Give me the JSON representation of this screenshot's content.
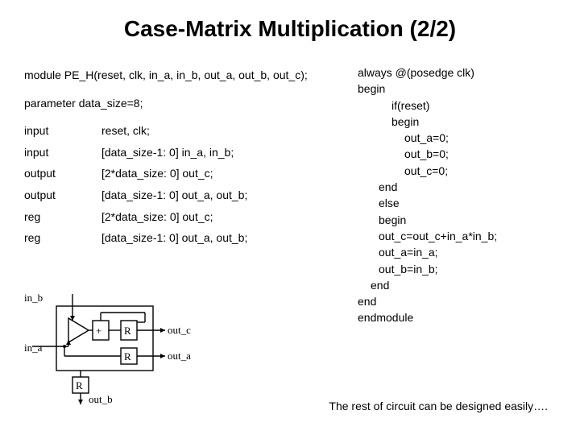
{
  "title": "Case-Matrix Multiplication (2/2)",
  "left": {
    "module": "module PE_H(reset, clk, in_a, in_b, out_a, out_b, out_c);",
    "param": "parameter data_size=8;",
    "decls": [
      {
        "kw": "input",
        "rest": "reset, clk;"
      },
      {
        "kw": "input",
        "rest": "[data_size-1: 0] in_a, in_b;"
      },
      {
        "kw": "output",
        "rest": "[2*data_size: 0] out_c;"
      },
      {
        "kw": "output",
        "rest": "[data_size-1: 0] out_a, out_b;"
      },
      {
        "kw": "reg",
        "rest": "[2*data_size: 0] out_c;"
      },
      {
        "kw": "reg",
        "rest": "[data_size-1: 0] out_a, out_b;"
      }
    ]
  },
  "right": {
    "l1": "always @(posedge clk)",
    "l2": "begin",
    "l3": "if(reset)",
    "l4": "begin",
    "l5": "out_a=0;",
    "l6": "out_b=0;",
    "l7": "out_c=0;",
    "l8": "end",
    "l9": "else",
    "l10": "begin",
    "l11": "out_c=out_c+in_a*in_b;",
    "l12": "out_a=in_a;",
    "l13": "out_b=in_b;",
    "l14": "end",
    "l15": "end",
    "l16": "endmodule"
  },
  "diagram": {
    "in_b": "in_b",
    "in_a": "in_a",
    "out_c": "out_c",
    "out_a": "out_a",
    "out_b": "out_b",
    "R": "R",
    "plus": "+"
  },
  "footer": "The rest of circuit can be designed easily…."
}
